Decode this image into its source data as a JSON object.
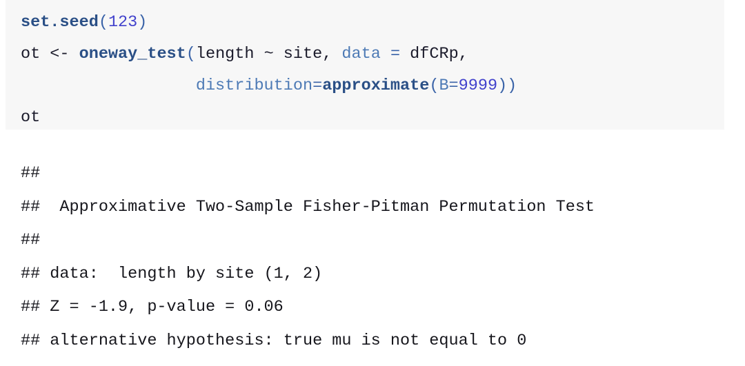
{
  "document": {
    "type": "r-markdown-rendered-output",
    "background_color": "#ffffff"
  },
  "code_chunk": {
    "background_color": "#f7f7f7",
    "language": "R",
    "colors": {
      "function": "#2a4f86",
      "number": "#4242cc",
      "argument": "#4d7ab5",
      "operator": "#3a63a8",
      "plain": "#1b1b2b"
    },
    "lines": [
      {
        "id": "line-1",
        "tokens": [
          {
            "text": "set.seed",
            "type": "function"
          },
          {
            "text": "(",
            "type": "paren"
          },
          {
            "text": "123",
            "type": "number"
          },
          {
            "text": ")",
            "type": "paren"
          }
        ],
        "plain_text": "set.seed(123)"
      },
      {
        "id": "line-2",
        "tokens": [
          {
            "text": "ot <- ",
            "type": "plain"
          },
          {
            "text": "oneway_test",
            "type": "function"
          },
          {
            "text": "(",
            "type": "paren"
          },
          {
            "text": "length ~ site, ",
            "type": "plain"
          },
          {
            "text": "data",
            "type": "argument"
          },
          {
            "text": " = ",
            "type": "operator"
          },
          {
            "text": "dfCRp,",
            "type": "plain"
          }
        ],
        "plain_text": "ot <- oneway_test(length ~ site, data = dfCRp,"
      },
      {
        "id": "line-3",
        "tokens": [
          {
            "text": "                  ",
            "type": "plain"
          },
          {
            "text": "distribution",
            "type": "argument"
          },
          {
            "text": "=",
            "type": "operator"
          },
          {
            "text": "approximate",
            "type": "function"
          },
          {
            "text": "(",
            "type": "paren"
          },
          {
            "text": "B",
            "type": "argument"
          },
          {
            "text": "=",
            "type": "operator"
          },
          {
            "text": "9999",
            "type": "number"
          },
          {
            "text": "))",
            "type": "paren"
          }
        ],
        "plain_text": "                  distribution=approximate(B=9999))"
      },
      {
        "id": "line-4",
        "tokens": [
          {
            "text": "ot",
            "type": "plain"
          }
        ],
        "plain_text": "ot"
      }
    ]
  },
  "console_output": {
    "comment_prefix": "##",
    "text_color": "#16161c",
    "lines": [
      "## ",
      "##  Approximative Two-Sample Fisher-Pitman Permutation Test",
      "## ",
      "## data:  length by site (1, 2)",
      "## Z = -1.9, p-value = 0.06",
      "## alternative hypothesis: true mu is not equal to 0"
    ],
    "test_results": {
      "test_name": "Approximative Two-Sample Fisher-Pitman Permutation Test",
      "data_description": "length by site (1, 2)",
      "Z": "-1.9",
      "p_value": "0.06",
      "alternative_hypothesis": "true mu is not equal to 0"
    }
  }
}
